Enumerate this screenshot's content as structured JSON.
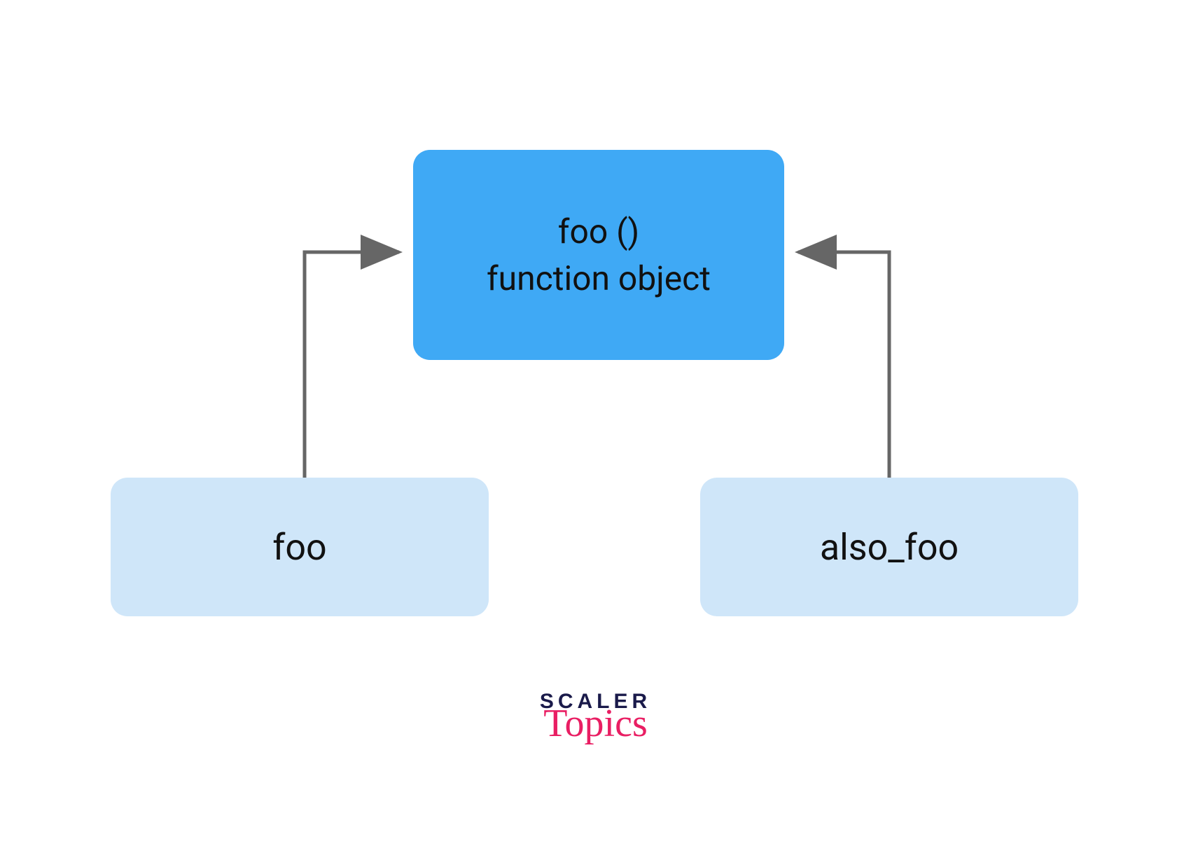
{
  "diagram": {
    "top_node": {
      "line1": "foo ()",
      "line2": "function object"
    },
    "bottom_left": {
      "label": "foo"
    },
    "bottom_right": {
      "label": "also_foo"
    },
    "colors": {
      "top_fill": "#3fa9f5",
      "bottom_fill": "#cfe6f9",
      "arrow": "#666666"
    }
  },
  "branding": {
    "line1": "SCALER",
    "line2": "Topics"
  }
}
